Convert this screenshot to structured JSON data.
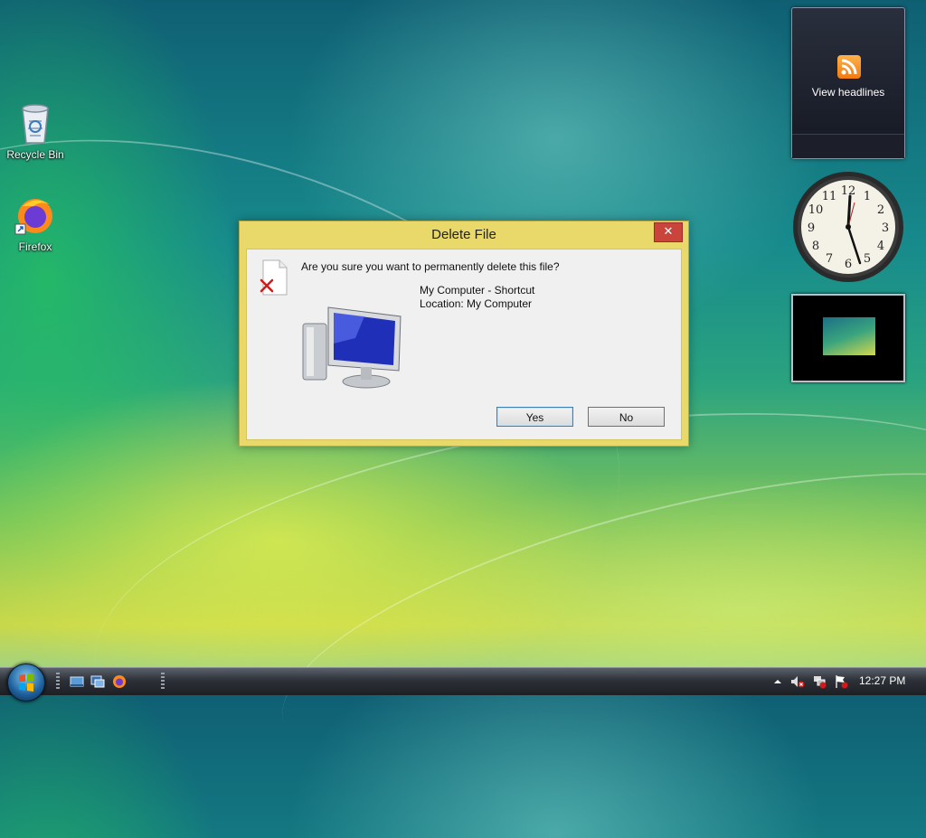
{
  "desktop": {
    "icons": [
      {
        "label": "Recycle Bin",
        "icon": "recycle-bin-icon"
      },
      {
        "label": "Firefox",
        "icon": "firefox-icon"
      }
    ]
  },
  "gadgets": {
    "rss": {
      "label": "View headlines",
      "icon": "rss-feed-icon"
    },
    "clock": {
      "hour": 12,
      "minute": 27
    },
    "slideshow": {
      "icon": "slideshow-icon"
    }
  },
  "dialog": {
    "title": "Delete File",
    "close_label": "✕",
    "question": "Are you sure you want to permanently delete this file?",
    "item_name": "My Computer - Shortcut",
    "item_location": "Location: My Computer",
    "yes_label": "Yes",
    "no_label": "No"
  },
  "taskbar": {
    "start": "start-orb-icon",
    "quick_launch": [
      "show-desktop-icon",
      "switch-windows-icon",
      "firefox-icon"
    ],
    "tray": [
      "show-hidden-icons-icon",
      "volume-muted-icon",
      "network-disconnected-icon",
      "action-center-icon"
    ],
    "time": "12:27 PM"
  },
  "colors": {
    "dialog_frame": "#e9d86a",
    "close_button": "#c9443b",
    "rss_orange": "#f27a10"
  }
}
